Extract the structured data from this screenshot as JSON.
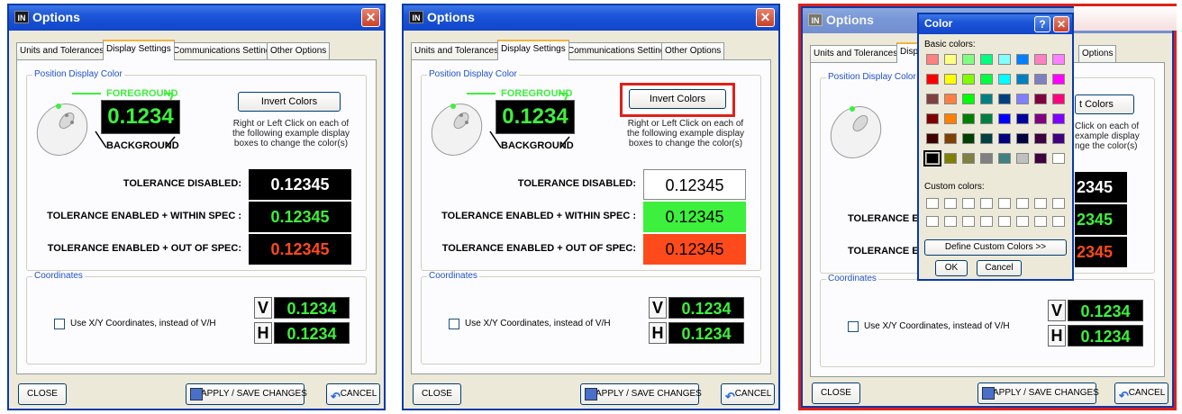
{
  "window": {
    "title": "Options",
    "icon_text": "IN"
  },
  "tabs": [
    "Units and Tolerances",
    "Display Settings",
    "Communications Settings",
    "Other Options"
  ],
  "display": {
    "group_label": "Position Display Color",
    "foreground_label": "FOREGROUND",
    "background_label": "BACKGROUND",
    "example_value": "0.1234",
    "invert_button": "Invert Colors",
    "hint_lines": [
      "Right or Left Click on each of",
      "the following example display",
      "boxes to change the color(s)"
    ]
  },
  "tolerance_rows": [
    {
      "label": "TOLERANCE DISABLED:",
      "value": "0.12345"
    },
    {
      "label": "TOLERANCE ENABLED + WITHIN SPEC :",
      "value": "0.12345"
    },
    {
      "label": "TOLERANCE ENABLED + OUT OF SPEC:",
      "value": "0.12345"
    }
  ],
  "tolerance_colors": {
    "before": [
      {
        "bg": "#000000",
        "fg": "#ffffff"
      },
      {
        "bg": "#000000",
        "fg": "#3df03d"
      },
      {
        "bg": "#000000",
        "fg": "#ff4a1c"
      }
    ],
    "after": [
      {
        "bg": "#ffffff",
        "fg": "#000000"
      },
      {
        "bg": "#3df03d",
        "fg": "#000000"
      },
      {
        "bg": "#ff4a1c",
        "fg": "#000000"
      }
    ]
  },
  "coordinates": {
    "group_label": "Coordinates",
    "checkbox_label": "Use X/Y Coordinates, instead of V/H",
    "v_letter": "V",
    "h_letter": "H",
    "v_value": "0.1234",
    "h_value": "0.1234"
  },
  "bottom": {
    "close": "CLOSE",
    "apply": "APPLY / SAVE CHANGES",
    "cancel": "CANCEL"
  },
  "panel3_partial": {
    "tab_fragment": "Disp",
    "tab_last": "Options",
    "invert_fragment": "t Colors",
    "hint_lines": [
      "Click on each of",
      "example display",
      "nge the color(s)"
    ],
    "row_label_fragment": "TOLERANCE E",
    "value_fragments": [
      "2345",
      "2345",
      "2345"
    ]
  },
  "color_dialog": {
    "title": "Color",
    "help": "?",
    "basic_label": "Basic colors:",
    "custom_label": "Custom colors:",
    "define_button": "Define Custom Colors >>",
    "ok": "OK",
    "cancel": "Cancel",
    "basic_colors": [
      [
        "#ff8080",
        "#ffff80",
        "#80ff80",
        "#00ff80",
        "#80ffff",
        "#0080ff",
        "#ff80c0",
        "#ff80ff"
      ],
      [
        "#ff0000",
        "#ffff00",
        "#80ff00",
        "#00ff40",
        "#00ffff",
        "#0080c0",
        "#8080c0",
        "#ff00ff"
      ],
      [
        "#804040",
        "#ff8040",
        "#00ff00",
        "#008080",
        "#004080",
        "#8080ff",
        "#800040",
        "#ff0080"
      ],
      [
        "#800000",
        "#ff8000",
        "#008000",
        "#008040",
        "#0000ff",
        "#0000a0",
        "#800080",
        "#8000ff"
      ],
      [
        "#400000",
        "#804000",
        "#004000",
        "#004040",
        "#000080",
        "#000040",
        "#400040",
        "#400080"
      ],
      [
        "#000000",
        "#808000",
        "#808040",
        "#808080",
        "#408080",
        "#c0c0c0",
        "#400040",
        "#ffffff"
      ]
    ]
  },
  "accent_colors": {
    "highlight_red": "#e0201a",
    "xp_blue": "#0a3aa8",
    "green_text": "#3df03d"
  }
}
